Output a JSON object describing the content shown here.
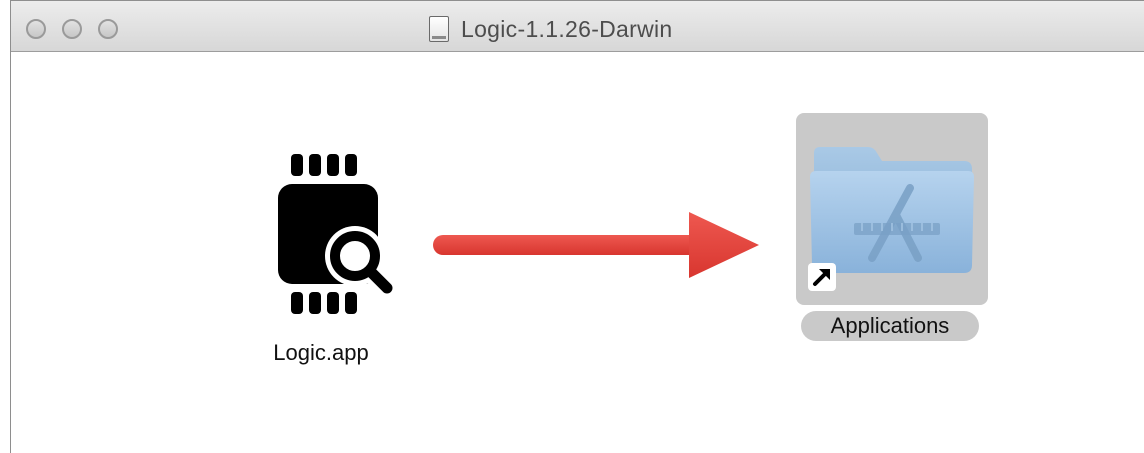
{
  "window": {
    "title": "Logic-1.1.26-Darwin"
  },
  "items": {
    "app": {
      "label": "Logic.app",
      "icon": "logic-app-icon"
    },
    "applications": {
      "label": "Applications",
      "icon": "applications-folder-icon",
      "alias_icon": "alias-arrow-icon"
    }
  },
  "arrow": {
    "icon": "drag-arrow-icon",
    "color": "#e8463f"
  },
  "colors": {
    "titlebar": "#dcdcdc",
    "selection": "#c9c9c9",
    "folder": "#8fb7dc"
  }
}
